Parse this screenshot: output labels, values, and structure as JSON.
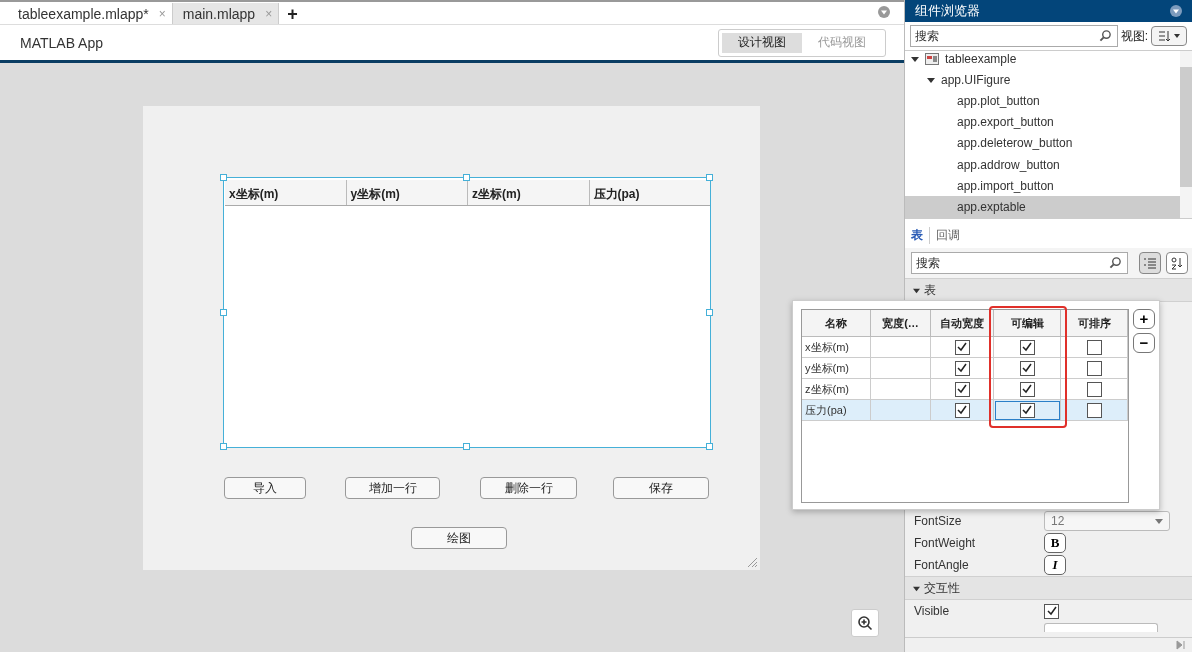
{
  "editor_tabs": [
    {
      "label": "tableexample.mlapp*",
      "selected": true,
      "close": "×"
    },
    {
      "label": "main.mlapp",
      "selected": false,
      "close": "×"
    }
  ],
  "new_tab": "+",
  "app_title": "MATLAB App",
  "view_toggle": [
    {
      "label": "设计视图",
      "selected": true
    },
    {
      "label": "代码视图",
      "selected": false
    }
  ],
  "canvas": {
    "table": {
      "columns": [
        "x坐标(m)",
        "y坐标(m)",
        "z坐标(m)",
        "压力(pa)"
      ]
    },
    "buttons": [
      {
        "label": "导入"
      },
      {
        "label": "增加一行"
      },
      {
        "label": "删除一行"
      },
      {
        "label": "保存"
      },
      {
        "label": "绘图"
      }
    ]
  },
  "component_browser": {
    "title": "组件浏览器",
    "search": {
      "placeholder": "搜索"
    },
    "view_label": "视图:",
    "tree": [
      {
        "label": "tableexample",
        "expanded": true,
        "selected": false,
        "children": [
          {
            "label": "app.UIFigure",
            "expanded": true,
            "selected": false,
            "children": [
              {
                "label": "app.plot_button",
                "selected": false
              },
              {
                "label": "app.export_button",
                "selected": false
              },
              {
                "label": "app.deleterow_button",
                "selected": false
              },
              {
                "label": "app.addrow_button",
                "selected": false
              },
              {
                "label": "app.import_button",
                "selected": false
              },
              {
                "label": "app.exptable",
                "selected": true
              }
            ]
          }
        ]
      }
    ]
  },
  "inspector": {
    "tabs": [
      {
        "label": "表",
        "selected": true
      },
      {
        "label": "回调",
        "selected": false
      }
    ],
    "search": {
      "placeholder": "搜索"
    },
    "section": "表",
    "column_editor": {
      "columns": [
        {
          "label": "名称",
          "highlighted": false
        },
        {
          "label": "宽度(…",
          "highlighted": false
        },
        {
          "label": "自动宽度",
          "highlighted": false
        },
        {
          "label": "可编辑",
          "highlighted": true
        },
        {
          "label": "可排序",
          "highlighted": false
        }
      ],
      "rows": [
        {
          "name": "x坐标(m)",
          "auto_width": true,
          "editable": true,
          "sortable": false,
          "selected": false
        },
        {
          "name": "y坐标(m)",
          "auto_width": true,
          "editable": true,
          "sortable": false,
          "selected": false
        },
        {
          "name": "z坐标(m)",
          "auto_width": true,
          "editable": true,
          "sortable": false,
          "selected": false
        },
        {
          "name": "压力(pa)",
          "auto_width": true,
          "editable": true,
          "sortable": false,
          "selected": true
        }
      ],
      "add": "+",
      "remove": "−"
    },
    "props": [
      {
        "name": "FontSize",
        "value": "12",
        "kind": "dropdown"
      },
      {
        "name": "FontWeight",
        "value": "B",
        "kind": "bold"
      },
      {
        "name": "FontAngle",
        "value": "I",
        "kind": "italic"
      }
    ],
    "section2": "交互性",
    "visible": {
      "name": "Visible",
      "checked": true
    }
  }
}
